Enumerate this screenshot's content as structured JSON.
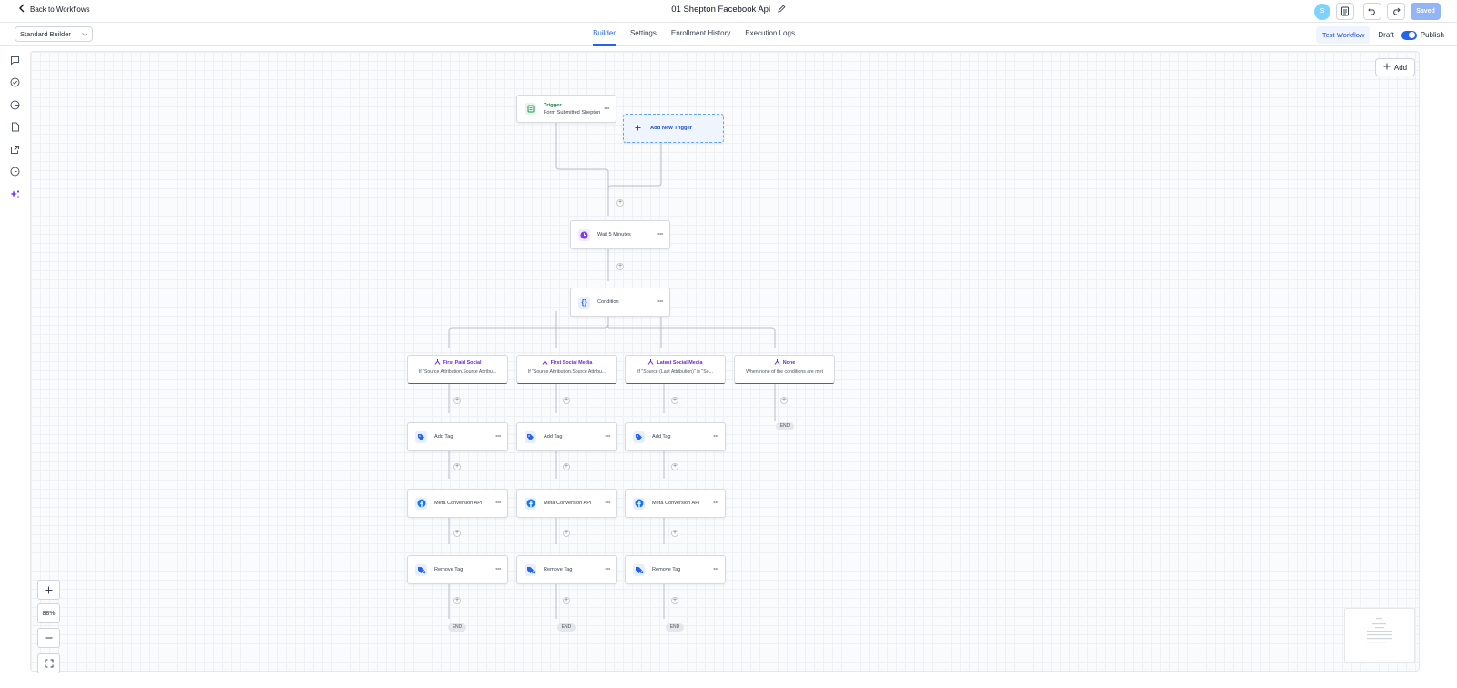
{
  "header": {
    "back_label": "Back to Workflows",
    "workflow_title": "01 Shepton Facebook Api",
    "saved_label": "Saved",
    "avatar_initial": "S"
  },
  "subheader": {
    "builder_select": "Standard Builder",
    "tabs": [
      {
        "label": "Builder",
        "active": true
      },
      {
        "label": "Settings",
        "active": false
      },
      {
        "label": "Enrollment History",
        "active": false
      },
      {
        "label": "Execution Logs",
        "active": false
      }
    ],
    "test_workflow_label": "Test Workflow",
    "draft_label": "Draft",
    "publish_label": "Publish"
  },
  "canvas": {
    "add_label": "Add",
    "zoom_level": "88%",
    "trigger": {
      "title": "Trigger",
      "subtitle": "Form Submitted Shepton"
    },
    "add_trigger_label": "Add New Trigger",
    "wait_label": "Wait 5 Minutes",
    "condition_label": "Condition",
    "branches": [
      {
        "title": "First Paid Social",
        "desc": "If \"Source Attribution.Source Attribu..."
      },
      {
        "title": "First Social Media",
        "desc": "If \"Source Attribution.Source Attribu..."
      },
      {
        "title": "Latest Social Media",
        "desc": "If \"Source (Last Attribution)\" is \"So..."
      },
      {
        "title": "None",
        "desc": "When none of the conditions are met"
      }
    ],
    "actions": {
      "add_tag": "Add Tag",
      "meta_api": "Meta Conversion API",
      "remove_tag": "Remove Tag"
    },
    "end_label": "END"
  },
  "colors": {
    "accent": "#2563eb",
    "branch_accent": "#7c3aed",
    "saved_button": "#93b4f5"
  }
}
